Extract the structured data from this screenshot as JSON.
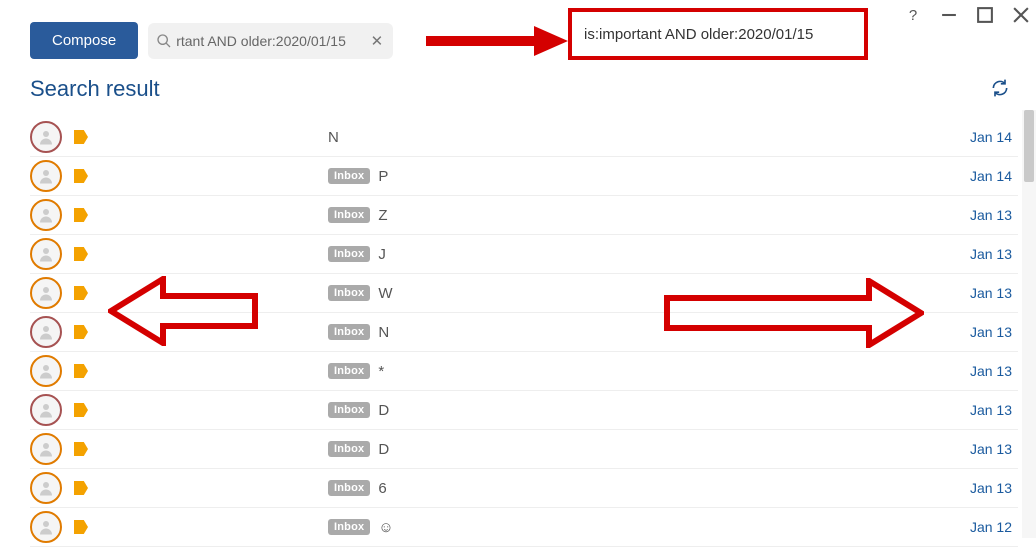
{
  "compose_label": "Compose",
  "search": {
    "value": "rtant AND older:2020/01/15"
  },
  "callout_text": "is:important AND older:2020/01/15",
  "section_title": "Search result",
  "inbox_badge": "Inbox",
  "rows": [
    {
      "avatar_color": "maroon",
      "has_badge": false,
      "subject": "N",
      "date": "Jan 14"
    },
    {
      "avatar_color": "orange",
      "has_badge": true,
      "subject": "P",
      "date": "Jan 14"
    },
    {
      "avatar_color": "orange",
      "has_badge": true,
      "subject": "Z",
      "date": "Jan 13"
    },
    {
      "avatar_color": "orange",
      "has_badge": true,
      "subject": "J",
      "date": "Jan 13"
    },
    {
      "avatar_color": "orange",
      "has_badge": true,
      "subject": "W",
      "date": "Jan 13"
    },
    {
      "avatar_color": "maroon",
      "has_badge": true,
      "subject": "N",
      "date": "Jan 13"
    },
    {
      "avatar_color": "orange",
      "has_badge": true,
      "subject": "*",
      "date": "Jan 13"
    },
    {
      "avatar_color": "maroon",
      "has_badge": true,
      "subject": "D",
      "date": "Jan 13"
    },
    {
      "avatar_color": "orange",
      "has_badge": true,
      "subject": "D",
      "date": "Jan 13"
    },
    {
      "avatar_color": "orange",
      "has_badge": true,
      "subject": "6",
      "date": "Jan 13"
    },
    {
      "avatar_color": "orange",
      "has_badge": true,
      "subject": "☺",
      "date": "Jan 12"
    }
  ]
}
